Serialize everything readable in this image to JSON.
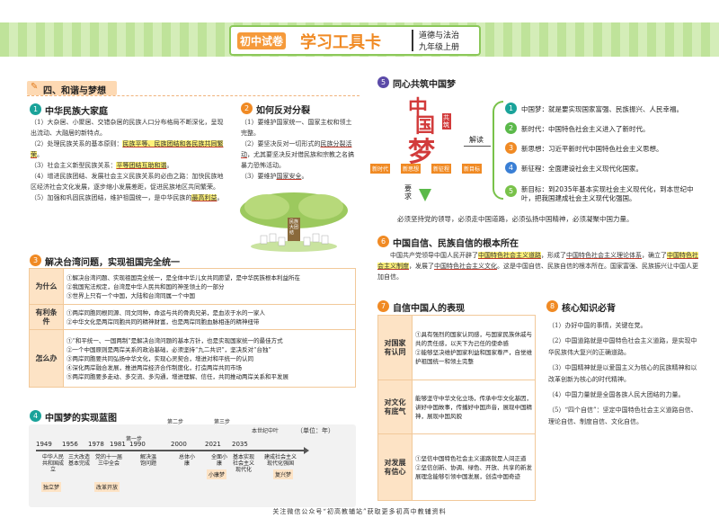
{
  "header": {
    "brand": "初中试卷",
    "title": "学习工具卡",
    "subject": "道德与法治",
    "grade": "九年级上册"
  },
  "s4": {
    "title": "四、和谐与梦想"
  },
  "s1": {
    "title": "中华民族大家庭",
    "p1": "（1）大杂居、小聚居、交错杂居的民族人口分布格局不断深化，呈现出流动、大融居的新特点。",
    "p2a": "（2）处理民族关系的基本原则：",
    "p2b": "民族平等、民族团结和各民族共同繁荣",
    "p2c": "。",
    "p3a": "（3）社会主义新型民族关系：",
    "p3b": "平等团结互助和谐",
    "p3c": "。",
    "p4": "（4）增进民族团结、发展社会主义民族关系的必由之路：加快民族地区经济社会文化发展，逐步缩小发展差距，促进民族地区共同繁荣。",
    "p5a": "（5）加强和巩固民族团结，维护祖国统一，是中华民族的",
    "p5b": "最高利益",
    "p5c": "。"
  },
  "s2": {
    "title": "如何反对分裂",
    "l1": "（1）要维护国家统一、国家主权和领土完整。",
    "l2a": "（2）要坚决反对一切形式的",
    "l2b": "民族分裂活动",
    "l2c": "，尤其要坚决反对借民族和宗教之名搞暴力恐怖活动。",
    "l3a": "（3）要维护",
    "l3b": "国家安全",
    "l3c": "。"
  },
  "tree": {
    "trunk": "民族大团结"
  },
  "s3": {
    "title": "解决台湾问题，实现祖国完全统一",
    "rows": [
      {
        "head": "为什么",
        "lines": [
          "①解决台湾问题、实现祖国完全统一，是全体中华儿女共同愿望，是中华民族根本利益所在",
          "②我国宪法规定，台湾是中华人民共和国的神圣领土的一部分",
          "③世界上只有一个中国，大陆和台湾同属一个中国"
        ]
      },
      {
        "head": "有利条件",
        "lines": [
          "①两岸同胞同根同源、同文同种，命运与共的骨肉兄弟，是血浓于水的一家人",
          "②中华文化是两岸同胞共同的精神财富，也是两岸同胞血脉相连的精神纽带"
        ]
      },
      {
        "head": "怎么办",
        "lines": [
          "①“和平统一、一国两制”是解决台湾问题的基本方针，也是实现国家统一的最佳方式",
          "②一个中国原则是两岸关系的政治基础，必须坚持“九二共识”，坚决反对“台独”",
          "③两岸同胞要共同弘扬中华文化，实现心灵契合，增进对和平统一的认同",
          "④深化两岸融合发展，推进两岸经济合作制度化，打造两岸共同市场",
          "⑤两岸同胞要多走动、多交流、多沟通，增进理解、信任，共同推动两岸关系和平发展"
        ]
      }
    ]
  },
  "s4b": {
    "title": "中国梦的实现蓝图",
    "unit": "（单位：年）",
    "steps": [
      "第二步",
      "第三步",
      "本世纪中叶"
    ],
    "years": [
      "1949",
      "1956",
      "1978",
      "1981",
      "1990",
      "2000",
      "2021",
      "2035"
    ],
    "first": "第一步",
    "events": [
      {
        "top": "中华人民共和国成立",
        "tag": "独立梦"
      },
      {
        "top": "三大改造基本完成",
        "tag": ""
      },
      {
        "top": "党的十一届三中全会",
        "tag": "改革开放"
      },
      {
        "top": "解决温饱问题",
        "tag": ""
      },
      {
        "top": "总体小康",
        "tag": ""
      },
      {
        "top": "全面小康",
        "tag": "小康梦"
      },
      {
        "top": "基本实现社会主义现代化",
        "tag": ""
      },
      {
        "top": "建成社会主义现代化强国",
        "tag": "复兴梦"
      }
    ]
  },
  "s5": {
    "title": "同心共筑中国梦",
    "art": [
      "中",
      "国",
      "梦",
      "共筑"
    ],
    "labels": [
      "新时代",
      "新思想",
      "新征程",
      "新目标"
    ],
    "read": "解读",
    "req": "要求",
    "items": [
      "中国梦：就是要实现国家富强、民族振兴、人民幸福。",
      "新时代：中国特色社会主义进入了新时代。",
      "新思想：习近平新时代中国特色社会主义思想。",
      "新征程：全面建设社会主义现代化国家。",
      "新目标：到2035年基本实现社会主义现代化，到本世纪中叶，把我国建成社会主义现代化强国。"
    ],
    "footer": "必须坚持党的领导，必须走中国道路，必须弘扬中国精神，必须凝聚中国力量。"
  },
  "s6": {
    "title": "中国自信、民族自信的根本所在",
    "t1": "中国共产党领导中国人民开辟了",
    "t2": "中国特色社会主义道路",
    "t3": "，形成了",
    "t4": "中国特色社会主义理论体系",
    "t5": "，确立了",
    "t6": "中国特色社会主义制度",
    "t7": "，发展了",
    "t8": "中国特色社会主义文化",
    "t9": "。这是中国自信、民族自信的根本所在。国家富强、民族振兴让中国人更加自信。"
  },
  "s7": {
    "title": "自信中国人的表现",
    "rows": [
      {
        "head": "对国家有认同",
        "lines": [
          "①具有强烈的国家认同感，与国家民族休戚与共的责任感，以天下为己任的使命感",
          "②能够坚决维护国家利益和国家尊严，自觉维护祖国统一和领土完整"
        ]
      },
      {
        "head": "对文化有底气",
        "lines": [
          "能够坚守中华文化立场，传承中华文化基因，讲好中国故事，传播好中国声音，展现中国精神，展现中国风貌"
        ]
      },
      {
        "head": "对发展有信心",
        "lines": [
          "①坚信中国特色社会主义道路就是人间正道",
          "②坚信创新、协调、绿色、开放、共享的新发展理念能够引领中国发展，创造中国奇迹"
        ]
      }
    ]
  },
  "s8": {
    "title": "核心知识必背",
    "lines": [
      "（1）办好中国的事情，关键在党。",
      "（2）中国道路就是中国特色社会主义道路，是实现中华民族伟大复兴的正确道路。",
      "（3）中国精神就是以爱国主义为核心的民族精神和以改革创新为核心的时代精神。",
      "（4）中国力量就是全国各族人民大团结的力量。",
      "（5）“四个自信”：坚定中国特色社会主义道路自信、理论自信、制度自信、文化自信。"
    ]
  },
  "footer": "关注微信公众号“初高教辅站”获取更多初高中教辅资料",
  "colors": {
    "orange": "#f08a24",
    "teal": "#1aa39a",
    "green": "#5bb94a",
    "purple": "#5b4aa8",
    "red": "#d23b3b",
    "header": "#79c24a"
  }
}
